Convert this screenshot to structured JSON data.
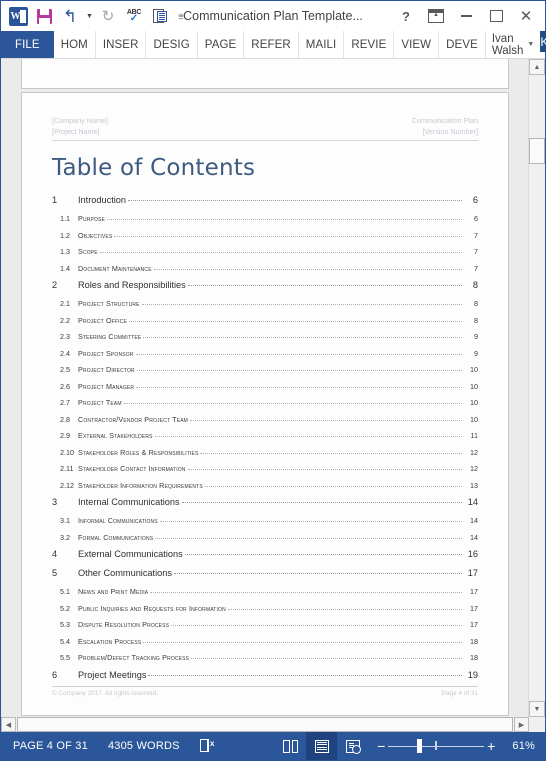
{
  "window": {
    "title": "Communication Plan Template...",
    "quick_access": [
      {
        "name": "word-logo",
        "label": "W"
      },
      {
        "name": "save-icon",
        "label": "Save"
      },
      {
        "name": "undo-icon",
        "label": "Undo"
      },
      {
        "name": "redo-icon",
        "label": "Redo"
      },
      {
        "name": "spelling-icon",
        "label": "ABC"
      },
      {
        "name": "print-preview-icon",
        "label": "Print Preview"
      },
      {
        "name": "customize-qat-icon",
        "label": "Customize Quick Access Toolbar"
      }
    ],
    "controls": {
      "help": "?",
      "ribbon_display": "Ribbon Display Options",
      "minimize": "Minimize",
      "restore": "Restore Down",
      "close": "Close"
    }
  },
  "ribbon": {
    "file_tab": "FILE",
    "tabs": [
      "HOM",
      "INSER",
      "DESIG",
      "PAGE",
      "REFER",
      "MAILI",
      "REVIE",
      "VIEW",
      "DEVE"
    ],
    "user_name": "Ivan Walsh",
    "user_initial": "K"
  },
  "document": {
    "header_left_line1": "[Company Name]",
    "header_left_line2": "[Project Name]",
    "header_right_line1": "Communication Plan",
    "header_right_line2": "[Version Number]",
    "title": "Table of Contents",
    "footer_left": "© Company 2017. All rights reserved.",
    "footer_right": "Page 4 of 31",
    "toc": [
      {
        "level": 1,
        "number": "1",
        "text": "Introduction",
        "page": "6"
      },
      {
        "level": 2,
        "number": "1.1",
        "text": "Purpose",
        "page": "6"
      },
      {
        "level": 2,
        "number": "1.2",
        "text": "Objectives",
        "page": "7"
      },
      {
        "level": 2,
        "number": "1.3",
        "text": "Scope",
        "page": "7"
      },
      {
        "level": 2,
        "number": "1.4",
        "text": "Document Maintenance",
        "page": "7"
      },
      {
        "level": 1,
        "number": "2",
        "text": "Roles and Responsibilities",
        "page": "8"
      },
      {
        "level": 2,
        "number": "2.1",
        "text": "Project Structure",
        "page": "8"
      },
      {
        "level": 2,
        "number": "2.2",
        "text": "Project Office",
        "page": "8"
      },
      {
        "level": 2,
        "number": "2.3",
        "text": "Steering Committee",
        "page": "9"
      },
      {
        "level": 2,
        "number": "2.4",
        "text": "Project Sponsor",
        "page": "9"
      },
      {
        "level": 2,
        "number": "2.5",
        "text": "Project Director",
        "page": "10"
      },
      {
        "level": 2,
        "number": "2.6",
        "text": "Project Manager",
        "page": "10"
      },
      {
        "level": 2,
        "number": "2.7",
        "text": "Project Team",
        "page": "10"
      },
      {
        "level": 2,
        "number": "2.8",
        "text": "Contractor/Vendor Project Team",
        "page": "10"
      },
      {
        "level": 2,
        "number": "2.9",
        "text": "External Stakeholders",
        "page": "11"
      },
      {
        "level": 2,
        "number": "2.10",
        "text": "Stakeholder Roles & Responsibilities",
        "page": "12"
      },
      {
        "level": 2,
        "number": "2.11",
        "text": "Stakeholder Contact Information",
        "page": "12"
      },
      {
        "level": 2,
        "number": "2.12",
        "text": "Stakeholder Information Requirements",
        "page": "13"
      },
      {
        "level": 1,
        "number": "3",
        "text": "Internal Communications",
        "page": "14"
      },
      {
        "level": 2,
        "number": "3.1",
        "text": "Informal Communications",
        "page": "14"
      },
      {
        "level": 2,
        "number": "3.2",
        "text": "Formal Communications",
        "page": "14"
      },
      {
        "level": 1,
        "number": "4",
        "text": "External Communications",
        "page": "16"
      },
      {
        "level": 1,
        "number": "5",
        "text": "Other Communications",
        "page": "17"
      },
      {
        "level": 2,
        "number": "5.1",
        "text": "News and Print Media",
        "page": "17"
      },
      {
        "level": 2,
        "number": "5.2",
        "text": "Public Inquiries and Requests for Information",
        "page": "17"
      },
      {
        "level": 2,
        "number": "5.3",
        "text": "Dispute Resolution Process",
        "page": "17"
      },
      {
        "level": 2,
        "number": "5.4",
        "text": "Escalation Process",
        "page": "18"
      },
      {
        "level": 2,
        "number": "5.5",
        "text": "Problem/Defect Tracking Process",
        "page": "18"
      },
      {
        "level": 1,
        "number": "6",
        "text": "Project Meetings",
        "page": "19"
      }
    ]
  },
  "status_bar": {
    "page_indicator": "PAGE 4 OF 31",
    "word_count": "4305 WORDS",
    "proofing_icon": "proofing-errors-icon",
    "views": [
      {
        "name": "read-mode",
        "label": "Read Mode",
        "active": false
      },
      {
        "name": "print-layout",
        "label": "Print Layout",
        "active": true
      },
      {
        "name": "web-layout",
        "label": "Web Layout",
        "active": false
      }
    ],
    "zoom_out": "−",
    "zoom_in": "+",
    "zoom_level": "61%"
  },
  "colors": {
    "word_blue": "#2b579a",
    "title_blue": "#3d5a80",
    "save_purple": "#b8399e",
    "active_view": "#1e4380"
  }
}
